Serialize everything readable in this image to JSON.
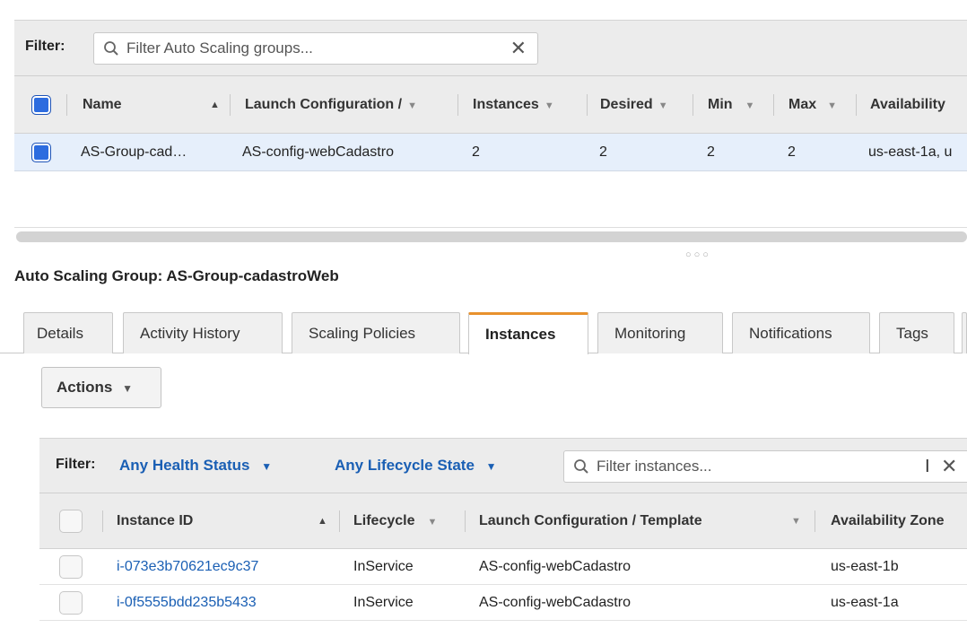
{
  "top": {
    "filter_label": "Filter:",
    "search_placeholder": "Filter Auto Scaling groups...",
    "columns": [
      "Name",
      "Launch Configuration /",
      "Instances",
      "Desired",
      "Min",
      "Max",
      "Availability"
    ],
    "row": {
      "name": "AS-Group-cad…",
      "launch_config": "AS-config-webCadastro",
      "instances": "2",
      "desired": "2",
      "min": "2",
      "max": "2",
      "availability": "us-east-1a, u"
    }
  },
  "asg_title": "Auto Scaling Group: AS-Group-cadastroWeb",
  "tabs": [
    "Details",
    "Activity History",
    "Scaling Policies",
    "Instances",
    "Monitoring",
    "Notifications",
    "Tags"
  ],
  "active_tab": "Instances",
  "actions_label": "Actions",
  "bottom": {
    "filter_label": "Filter:",
    "health_dropdown": "Any Health Status",
    "lifecycle_dropdown": "Any Lifecycle State",
    "search_placeholder": "Filter instances...",
    "columns": [
      "Instance ID",
      "Lifecycle",
      "Launch Configuration / Template",
      "Availability Zone"
    ],
    "rows": [
      {
        "instance_id": "i-073e3b70621ec9c37",
        "lifecycle": "InService",
        "launch_config": "AS-config-webCadastro",
        "zone": "us-east-1b"
      },
      {
        "instance_id": "i-0f5555bdd235b5433",
        "lifecycle": "InService",
        "launch_config": "AS-config-webCadastro",
        "zone": "us-east-1a"
      }
    ]
  },
  "colors": {
    "accent_tab": "#e8912d",
    "link": "#1a5fb4",
    "selected_row": "#e6effb",
    "checkbox_blue": "#2d6cdf"
  }
}
